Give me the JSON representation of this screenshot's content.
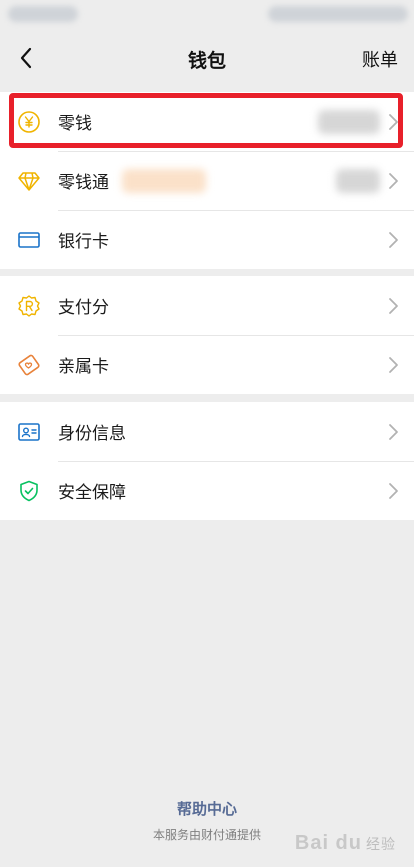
{
  "nav": {
    "title": "钱包",
    "right_label": "账单",
    "back_icon": "back-chevron-icon"
  },
  "groups": [
    {
      "items": [
        {
          "label": "零钱",
          "icon": "coin-yen-icon",
          "icon_color": "#f0b400"
        },
        {
          "label": "零钱通",
          "icon": "diamond-icon",
          "icon_color": "#f0b400"
        },
        {
          "label": "银行卡",
          "icon": "bank-card-icon",
          "icon_color": "#1a73c9"
        }
      ]
    },
    {
      "items": [
        {
          "label": "支付分",
          "icon": "score-badge-icon",
          "icon_color": "#f0b400"
        },
        {
          "label": "亲属卡",
          "icon": "family-card-icon",
          "icon_color": "#e8823a"
        }
      ]
    },
    {
      "items": [
        {
          "label": "身份信息",
          "icon": "id-card-icon",
          "icon_color": "#1a73c9"
        },
        {
          "label": "安全保障",
          "icon": "shield-check-icon",
          "icon_color": "#07c160"
        }
      ]
    }
  ],
  "footer": {
    "help_label": "帮助中心",
    "provider_text": "本服务由财付通提供"
  },
  "watermark": {
    "text": "Bai du",
    "sub": "经验"
  },
  "colors": {
    "background": "#ededed",
    "link": "#576b95",
    "highlight": "#e8202a"
  }
}
